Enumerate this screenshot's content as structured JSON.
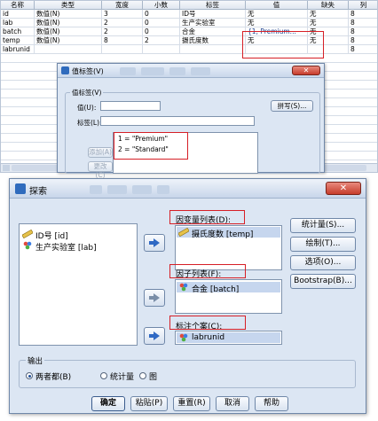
{
  "grid": {
    "headers": [
      "名称",
      "类型",
      "宽度",
      "小数",
      "标签",
      "值",
      "缺失",
      "列"
    ],
    "rows": [
      {
        "name": "id",
        "type": "数值(N)",
        "width": "3",
        "decimals": "0",
        "label": "ID号",
        "values": "无",
        "missing": "无",
        "columns": "8"
      },
      {
        "name": "lab",
        "type": "数值(N)",
        "width": "2",
        "decimals": "0",
        "label": "生产实验室",
        "values": "无",
        "missing": "无",
        "columns": "8"
      },
      {
        "name": "batch",
        "type": "数值(N)",
        "width": "2",
        "decimals": "0",
        "label": "合金",
        "values": "{1, Premium...",
        "missing": "无",
        "columns": "8"
      },
      {
        "name": "temp",
        "type": "数值(N)",
        "width": "8",
        "decimals": "2",
        "label": "摄氏度数",
        "values": "无",
        "missing": "无",
        "columns": "8"
      },
      {
        "name": "labrunid",
        "type": "",
        "width": "",
        "decimals": "",
        "label": "",
        "values": "",
        "missing": "",
        "columns": "8"
      }
    ]
  },
  "value_labels_dialog": {
    "title": "值标签(V)",
    "group_label": "值标签(V)",
    "value_label": "值(U):",
    "label_label": "标签(L):",
    "spelling_button": "拼写(S)...",
    "add_button": "添加(A)",
    "change_button": "更改(C)",
    "entries": [
      "1 = \"Premium\"",
      "2 = \"Standard\""
    ]
  },
  "explore_dialog": {
    "title": "探索",
    "source_items": [
      {
        "icon": "ruler-scale-icon",
        "label": "ID号 [id]"
      },
      {
        "icon": "nominal-icon",
        "label": "生产实验室 [lab]"
      }
    ],
    "dependent_label": "因变量列表(D):",
    "dependent_items": [
      "摄氏度数 [temp]"
    ],
    "factor_label": "因子列表(F):",
    "factor_items": [
      "合金 [batch]"
    ],
    "case_label": "标注个案(C):",
    "case_item": "labrunid",
    "side_buttons": [
      "统计量(S)...",
      "绘制(T)...",
      "选项(O)...",
      "Bootstrap(B)..."
    ],
    "output_group": "输出",
    "output_options": [
      "两者都(B)",
      "统计量",
      "图"
    ],
    "output_selected": "两者都(B)",
    "bottom_buttons": [
      "确定",
      "粘贴(P)",
      "重置(R)",
      "取消",
      "帮助"
    ]
  },
  "colors": {
    "highlight": "#d61f26",
    "dialog_bg": "#dce6f3",
    "selection": "#c6d6ee"
  }
}
